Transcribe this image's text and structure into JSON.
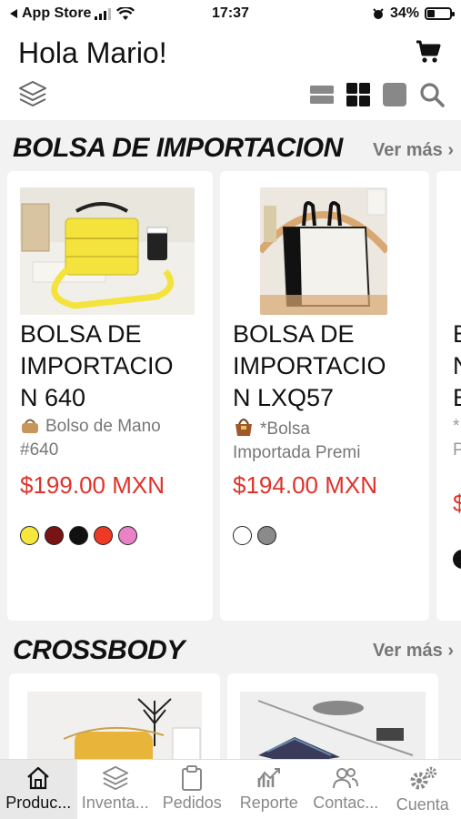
{
  "status_bar": {
    "carrier": "App Store",
    "time": "17:37",
    "battery": "34%",
    "battery_level": 0.34
  },
  "header": {
    "greeting": "Hola Mario!"
  },
  "sections": [
    {
      "title": "BOLSA DE IMPORTACION",
      "more": "Ver más",
      "products": [
        {
          "title": "BOLSA DE IMPORTACIO N 640",
          "title_lines": [
            "BOLSA DE",
            "IMPORTACIO",
            "N 640"
          ],
          "desc_lines": [
            "Bolso de Mano",
            "#640"
          ],
          "price": "$199.00 MXN",
          "colors": [
            "#f4e83c",
            "#7a1414",
            "#111111",
            "#ee3a24",
            "#ea82c7"
          ]
        },
        {
          "title": "BOLSA DE IMPORTACIO N LXQ57",
          "title_lines": [
            "BOLSA DE",
            "IMPORTACIO",
            "N LXQ57"
          ],
          "desc_lines": [
            "*Bolsa",
            "Importada Premi"
          ],
          "price": "$194.00 MXN",
          "colors": [
            "#ffffff",
            "#8a8a8a"
          ]
        }
      ]
    },
    {
      "title": "CROSSBODY",
      "more": "Ver más"
    }
  ],
  "tabs": [
    {
      "label": "Produc...",
      "icon": "home-icon",
      "active": true
    },
    {
      "label": "Inventa...",
      "icon": "layers-icon",
      "active": false
    },
    {
      "label": "Pedidos",
      "icon": "clipboard-icon",
      "active": false
    },
    {
      "label": "Reporte",
      "icon": "chart-icon",
      "active": false
    },
    {
      "label": "Contac...",
      "icon": "contacts-icon",
      "active": false
    },
    {
      "label": "Cuenta",
      "icon": "gears-icon",
      "active": false
    }
  ],
  "colors": {
    "price": "#e0322a",
    "muted": "#777777",
    "background": "#f2f2f2"
  }
}
